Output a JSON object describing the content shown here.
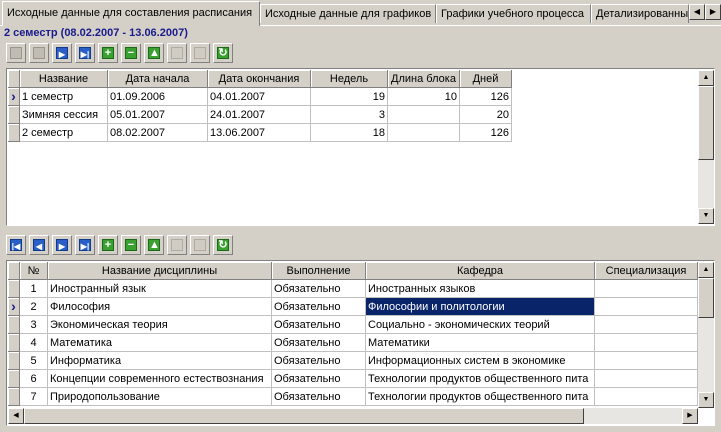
{
  "tabs": [
    {
      "label": "Исходные данные для составления расписания",
      "active": true
    },
    {
      "label": "Исходные данные для графиков",
      "active": false
    },
    {
      "label": "Графики учебного процесса",
      "active": false
    },
    {
      "label": "Детализированные",
      "active": false
    }
  ],
  "semester_title": "2 семестр (08.02.2007 - 13.06.2007)",
  "semesters_grid": {
    "columns": [
      "Название",
      "Дата начала",
      "Дата окончания",
      "Недель",
      "Длина блока",
      "Дней"
    ],
    "rows": [
      {
        "name": "1 семестр",
        "start": "01.09.2006",
        "end": "04.01.2007",
        "weeks": "19",
        "block": "10",
        "days": "126",
        "current": true
      },
      {
        "name": "Зимняя сессия",
        "start": "05.01.2007",
        "end": "24.01.2007",
        "weeks": "3",
        "block": "",
        "days": "20",
        "current": false
      },
      {
        "name": "2 семестр",
        "start": "08.02.2007",
        "end": "13.06.2007",
        "weeks": "18",
        "block": "",
        "days": "126",
        "current": false
      }
    ]
  },
  "disciplines_grid": {
    "columns": [
      "№",
      "Название дисциплины",
      "Выполнение",
      "Кафедра",
      "Специализация"
    ],
    "rows": [
      {
        "num": "1",
        "name": "Иностранный язык",
        "mode": "Обязательно",
        "dept": "Иностранных языков",
        "spec": "",
        "current": false
      },
      {
        "num": "2",
        "name": "Философия",
        "mode": "Обязательно",
        "dept": "Философии и политологии",
        "spec": "",
        "current": true
      },
      {
        "num": "3",
        "name": "Экономическая теория",
        "mode": "Обязательно",
        "dept": "Социально - экономических теорий",
        "spec": "",
        "current": false
      },
      {
        "num": "4",
        "name": "Математика",
        "mode": "Обязательно",
        "dept": "Математики",
        "spec": "",
        "current": false
      },
      {
        "num": "5",
        "name": "Информатика",
        "mode": "Обязательно",
        "dept": "Информационных систем в экономике",
        "spec": "",
        "current": false
      },
      {
        "num": "6",
        "name": "Концепции современного естествознания",
        "mode": "Обязательно",
        "dept": "Технологии продуктов общественного пита",
        "spec": "",
        "current": false
      },
      {
        "num": "7",
        "name": "Природопользование",
        "mode": "Обязательно",
        "dept": "Технологии продуктов общественного пита",
        "spec": "",
        "current": false
      }
    ]
  },
  "toolbar_top": [
    {
      "icon": "first-record-icon",
      "state": "disabled"
    },
    {
      "icon": "prior-record-icon",
      "state": "disabled"
    },
    {
      "icon": "next-record-icon",
      "state": "enabled"
    },
    {
      "icon": "last-record-icon",
      "state": "enabled"
    },
    {
      "icon": "insert-record-icon",
      "state": "enabled"
    },
    {
      "icon": "delete-record-icon",
      "state": "enabled"
    },
    {
      "icon": "edit-record-icon",
      "state": "enabled"
    },
    {
      "icon": "post-edit-icon",
      "state": "disabled"
    },
    {
      "icon": "cancel-edit-icon",
      "state": "disabled"
    },
    {
      "icon": "refresh-data-icon",
      "state": "enabled"
    }
  ],
  "toolbar_bottom": [
    {
      "icon": "first-record-icon",
      "state": "enabled"
    },
    {
      "icon": "prior-record-icon",
      "state": "enabled"
    },
    {
      "icon": "next-record-icon",
      "state": "enabled"
    },
    {
      "icon": "last-record-icon",
      "state": "enabled"
    },
    {
      "icon": "insert-record-icon",
      "state": "enabled"
    },
    {
      "icon": "delete-record-icon",
      "state": "enabled"
    },
    {
      "icon": "edit-record-icon",
      "state": "enabled"
    },
    {
      "icon": "post-edit-icon",
      "state": "disabled"
    },
    {
      "icon": "cancel-edit-icon",
      "state": "disabled"
    },
    {
      "icon": "refresh-data-icon",
      "state": "enabled"
    }
  ],
  "colors": {
    "selection": "#0a246a",
    "title": "#1a1a8c",
    "navigator_blue": "#2a5fc8",
    "navigator_green": "#3aa030"
  }
}
